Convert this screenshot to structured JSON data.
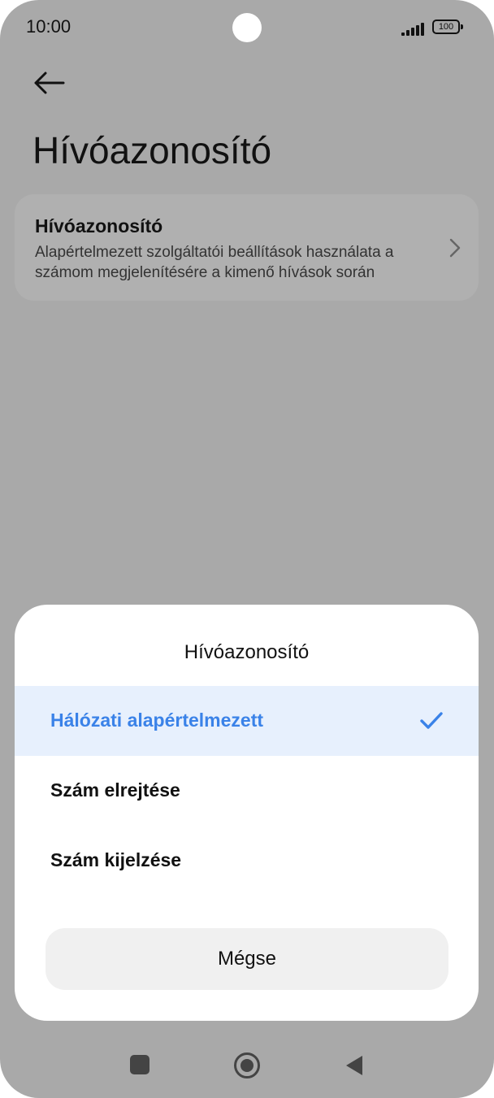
{
  "status_bar": {
    "time": "10:00",
    "battery": "100",
    "signal_icon": "signal-icon",
    "battery_icon": "battery-icon"
  },
  "header": {
    "back_icon": "back-arrow-icon",
    "title": "Hívóazonosító"
  },
  "setting_card": {
    "title": "Hívóazonosító",
    "description": "Alapértelmezett szolgáltatói beállítások használata a számom megjelenítésére a kimenő hívások során",
    "chevron_icon": "chevron-right-icon"
  },
  "dialog": {
    "title": "Hívóazonosító",
    "options": [
      {
        "label": "Hálózati alapértelmezett",
        "selected": true
      },
      {
        "label": "Szám elrejtése",
        "selected": false
      },
      {
        "label": "Szám kijelzése",
        "selected": false
      }
    ],
    "cancel_label": "Mégse",
    "check_icon": "check-icon"
  },
  "nav_bar": {
    "recents_icon": "recents-icon",
    "home_icon": "home-icon",
    "back_icon": "back-triangle-icon"
  },
  "colors": {
    "accent": "#3a82e8",
    "selected_bg": "#e7f0fd",
    "scrim": "#a9a9a9"
  }
}
